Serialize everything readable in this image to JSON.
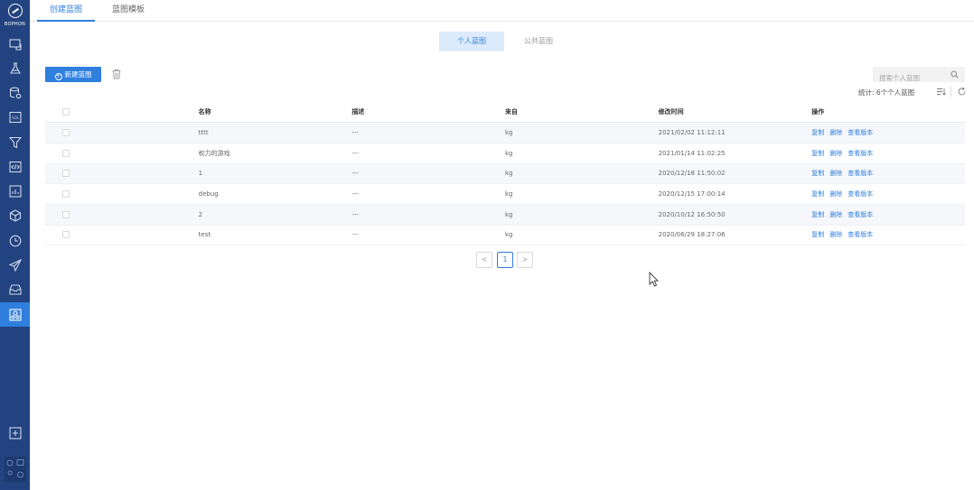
{
  "app": {
    "logo_text": "BOPHON",
    "accent": "#2f7fde",
    "sidebar_bg": "#22437f"
  },
  "sidebar": {
    "icons": [
      "device-icon",
      "lab-flask-icon",
      "database-icon",
      "sql-icon",
      "funnel-icon",
      "code-icon",
      "chart-box-icon",
      "cube-icon",
      "clock-icon",
      "paper-plane-icon",
      "inbox-icon",
      "blueprint-icon"
    ],
    "active_index": 11,
    "bottom": [
      "add-box-icon",
      "settings-icon",
      "display-icon",
      "user-icon",
      "info-icon"
    ]
  },
  "top_tabs": [
    "创建蓝图",
    "蓝图模板"
  ],
  "segments": [
    "个人蓝图",
    "公共蓝图"
  ],
  "toolbar": {
    "new_label": "新建蓝图",
    "search_placeholder": "搜索个人蓝图",
    "stats": "统计: 6个个人蓝图"
  },
  "table": {
    "headers": [
      "名称",
      "描述",
      "来自",
      "修改时间",
      "操作"
    ],
    "actions": [
      "复制",
      "删除",
      "查看版本"
    ],
    "rows": [
      {
        "name": "tttt",
        "desc": "---",
        "from": "kg",
        "time": "2021/02/02 11:12:11"
      },
      {
        "name": "权力的游戏",
        "desc": "---",
        "from": "kg",
        "time": "2021/01/14 11:02:25"
      },
      {
        "name": "1",
        "desc": "---",
        "from": "kg",
        "time": "2020/12/18 11:50:02"
      },
      {
        "name": "debug",
        "desc": "---",
        "from": "kg",
        "time": "2020/12/15 17:00:14"
      },
      {
        "name": "2",
        "desc": "---",
        "from": "kg",
        "time": "2020/10/12 16:50:50"
      },
      {
        "name": "test",
        "desc": "---",
        "from": "kg",
        "time": "2020/06/29 18:27:06"
      }
    ]
  },
  "pagination": {
    "prev": "<",
    "current": "1",
    "next": ">"
  }
}
